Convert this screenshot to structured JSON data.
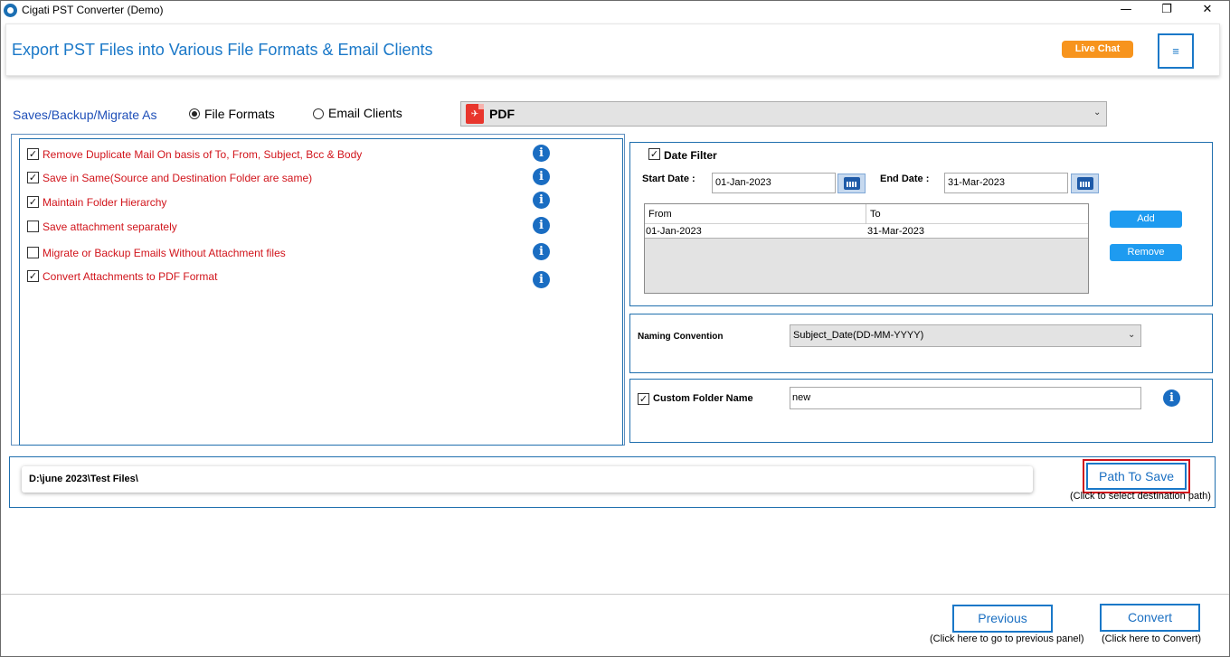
{
  "window": {
    "title": "Cigati PST Converter (Demo)",
    "minimize": "—",
    "maximize": "❐",
    "close": "✕"
  },
  "header": {
    "title": "Export PST Files into Various File Formats & Email Clients",
    "live_chat": "Live Chat",
    "menu_icon": "≡"
  },
  "saves": {
    "label": "Saves/Backup/Migrate As",
    "options": [
      {
        "label": "File Formats",
        "selected": true
      },
      {
        "label": "Email Clients",
        "selected": false
      }
    ],
    "format_value": "PDF",
    "format_icon": "pdf-icon"
  },
  "options": [
    {
      "label": "Remove Duplicate Mail On basis of To, From, Subject, Bcc & Body",
      "checked": true
    },
    {
      "label": "Save in Same(Source and Destination Folder are same)",
      "checked": true
    },
    {
      "label": "Maintain Folder Hierarchy",
      "checked": true
    },
    {
      "label": "Save attachment separately",
      "checked": false
    },
    {
      "label": "Migrate or Backup Emails Without Attachment files",
      "checked": false
    },
    {
      "label": "Convert Attachments to PDF Format",
      "checked": true
    }
  ],
  "date_filter": {
    "label": "Date Filter",
    "checked": true,
    "start_label": "Start Date :",
    "start_value": "01-Jan-2023",
    "end_label": "End Date :",
    "end_value": "31-Mar-2023",
    "columns": [
      "From",
      "To"
    ],
    "rows": [
      [
        "01-Jan-2023",
        "31-Mar-2023"
      ]
    ],
    "add_label": "Add",
    "remove_label": "Remove"
  },
  "naming": {
    "label": "Naming Convention",
    "value": "Subject_Date(DD-MM-YYYY)"
  },
  "custom_folder": {
    "label": "Custom Folder Name",
    "checked": true,
    "value": "new"
  },
  "path": {
    "value": "D:\\june 2023\\Test Files\\",
    "button": "Path To Save",
    "hint": "(Click to select destination path)"
  },
  "footer": {
    "previous": "Previous",
    "previous_hint": "(Click here to go to previous panel)",
    "convert": "Convert",
    "convert_hint": "(Click here to Convert)"
  },
  "colors": {
    "accent": "#1a78c8",
    "option_text": "#d1141b",
    "live_chat": "#f7941d",
    "highlight": "#d0121b"
  }
}
